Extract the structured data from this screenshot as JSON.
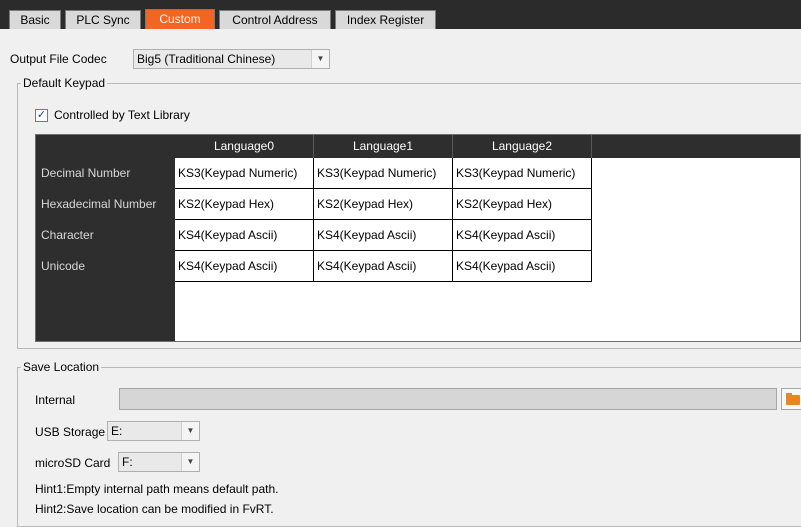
{
  "tabs": [
    {
      "label": "Basic",
      "active": false
    },
    {
      "label": "PLC Sync",
      "active": false
    },
    {
      "label": "Custom",
      "active": true
    },
    {
      "label": "Control Address",
      "active": false
    },
    {
      "label": "Index Register",
      "active": false
    }
  ],
  "codec": {
    "label": "Output File Codec",
    "value": "Big5 (Traditional Chinese)"
  },
  "default_keypad": {
    "title": "Default Keypad",
    "checkbox_label": "Controlled by Text Library",
    "checked": true,
    "columns": [
      "Language0",
      "Language1",
      "Language2"
    ],
    "rows": [
      {
        "label": "Decimal Number",
        "cells": [
          "KS3(Keypad Numeric)",
          "KS3(Keypad Numeric)",
          "KS3(Keypad Numeric)"
        ]
      },
      {
        "label": "Hexadecimal Number",
        "cells": [
          "KS2(Keypad Hex)",
          "KS2(Keypad Hex)",
          "KS2(Keypad Hex)"
        ]
      },
      {
        "label": "Character",
        "cells": [
          "KS4(Keypad Ascii)",
          "KS4(Keypad Ascii)",
          "KS4(Keypad Ascii)"
        ]
      },
      {
        "label": "Unicode",
        "cells": [
          "KS4(Keypad Ascii)",
          "KS4(Keypad Ascii)",
          "KS4(Keypad Ascii)"
        ]
      }
    ]
  },
  "save_location": {
    "title": "Save Location",
    "internal_label": "Internal",
    "internal_value": "",
    "usb_label": "USB Storage",
    "usb_value": "E:",
    "sd_label": "microSD Card",
    "sd_value": "F:",
    "hint1": "Hint1:Empty internal path means default path.",
    "hint2": "Hint2:Save location can be modified in FvRT."
  },
  "colors": {
    "active_tab": "#f26522",
    "grid_header": "#2e2e2e",
    "folder": "#e8861f"
  }
}
